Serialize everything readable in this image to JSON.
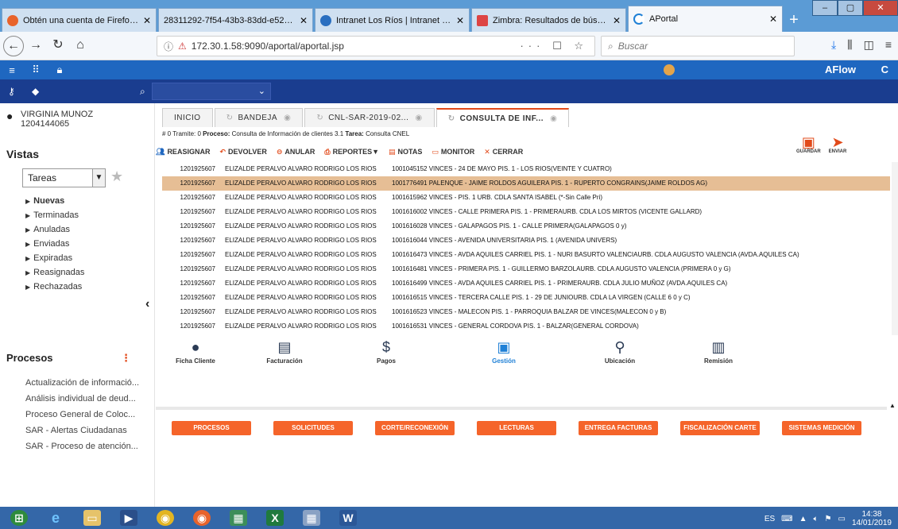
{
  "browser": {
    "tabs": [
      {
        "title": "Obtén una cuenta de Firefox – ",
        "color": "#e8632b"
      },
      {
        "title": "28311292-7f54-43b3-83dd-e529861",
        "color": "#ffffff"
      },
      {
        "title": "Intranet Los Ríos | Intranet Los ",
        "color": "#2a6fc0"
      },
      {
        "title": "Zimbra: Resultados de búsqued",
        "color": "#d44"
      },
      {
        "title": "APortal",
        "color": "#ffffff"
      }
    ],
    "new_tab": "+",
    "url": "172.30.1.58:9090/aportal/aportal.jsp",
    "url_icons": "··· ☐ ☆",
    "search_placeholder": "Buscar"
  },
  "appbar": {
    "brand": "AFlow",
    "refresh": "C"
  },
  "sidebar": {
    "user_name": "VIRGINIA MUNOZ",
    "user_id": "1204144065",
    "vistas_title": "Vistas",
    "vistas_select": "Tareas",
    "vistas_items": [
      "Nuevas",
      "Terminadas",
      "Anuladas",
      "Enviadas",
      "Expiradas",
      "Reasignadas",
      "Rechazadas"
    ],
    "procesos_title": "Procesos",
    "procesos_items": [
      "Actualización de informació...",
      "Análisis individual de deud...",
      "Proceso General de Coloc...",
      "SAR - Alertas Ciudadanas",
      "SAR - Proceso de atención..."
    ]
  },
  "main": {
    "tabs": [
      "INICIO",
      "BANDEJA",
      "CNL-SAR-2019-02...",
      "CONSULTA DE INF..."
    ],
    "info": {
      "tramite_label": "# 0 Tramite:",
      "tramite_val": "0",
      "proceso_label": "Proceso:",
      "proceso_val": "Consulta de Información de clientes 3.1",
      "tarea_label": "Tarea:",
      "tarea_val": "Consulta CNEL"
    },
    "toolbar": [
      "REASIGNAR",
      "DEVOLVER",
      "ANULAR",
      "REPORTES▼",
      "NOTAS",
      "MONITOR",
      "CERRAR"
    ],
    "save_label": "GUARDAR",
    "send_label": "ENVIAR",
    "rows": [
      {
        "id": "1201925607",
        "name": "ELIZALDE PERALVO ALVARO RODRIGO  LOS RIOS",
        "detail": "1001045152  VINCES - 24 DE MAYO PIS. 1 - LOS RIOS(VEINTE Y CUATRO)"
      },
      {
        "id": "1201925607",
        "name": "ELIZALDE PERALVO ALVARO RODRIGO  LOS RIOS",
        "detail": "1001776491  PALENQUE - JAIME ROLDOS AGUILERA PIS. 1 - RUPERTO CONGRAINS(JAIME ROLDOS AG)"
      },
      {
        "id": "1201925607",
        "name": "ELIZALDE PERALVO ALVARO RODRIGO  LOS RIOS",
        "detail": "1001615962  VINCES - PIS. 1 URB. CDLA SANTA ISABEL (*-Sin Calle Pri)"
      },
      {
        "id": "1201925607",
        "name": "ELIZALDE PERALVO ALVARO RODRIGO  LOS RIOS",
        "detail": "1001616002  VINCES - CALLE PRIMERA PIS. 1 - PRIMERAURB. CDLA LOS MIRTOS (VICENTE GALLARD)"
      },
      {
        "id": "1201925607",
        "name": "ELIZALDE PERALVO ALVARO RODRIGO  LOS RIOS",
        "detail": "1001616028  VINCES - GALAPAGOS PIS. 1 - CALLE PRIMERA(GALAPAGOS 0 y)"
      },
      {
        "id": "1201925607",
        "name": "ELIZALDE PERALVO ALVARO RODRIGO  LOS RIOS",
        "detail": "1001616044  VINCES - AVENIDA UNIVERSITARIA PIS. 1 (AVENIDA UNIVERS)"
      },
      {
        "id": "1201925607",
        "name": "ELIZALDE PERALVO ALVARO RODRIGO  LOS RIOS",
        "detail": "1001616473  VINCES - AVDA AQUILES CARRIEL PIS. 1 - NURI BASURTO VALENCIAURB. CDLA AUGUSTO VALENCIA (AVDA.AQUILES CA)"
      },
      {
        "id": "1201925607",
        "name": "ELIZALDE PERALVO ALVARO RODRIGO  LOS RIOS",
        "detail": "1001616481  VINCES - PRIMERA PIS. 1 - GUILLERMO BARZOLAURB. CDLA AUGUSTO VALENCIA (PRIMERA 0 y G)"
      },
      {
        "id": "1201925607",
        "name": "ELIZALDE PERALVO ALVARO RODRIGO  LOS RIOS",
        "detail": "1001616499  VINCES - AVDA AQUILES CARRIEL PIS. 1 - PRIMERAURB. CDLA JULIO MUÑOZ (AVDA.AQUILES CA)"
      },
      {
        "id": "1201925607",
        "name": "ELIZALDE PERALVO ALVARO RODRIGO  LOS RIOS",
        "detail": "1001616515  VINCES - TERCERA CALLE PIS. 1 - 29 DE JUNIOURB. CDLA LA VIRGEN (CALLE 6 0 y C)"
      },
      {
        "id": "1201925607",
        "name": "ELIZALDE PERALVO ALVARO RODRIGO  LOS RIOS",
        "detail": "1001616523  VINCES - MALECON PIS. 1 - PARROQUIA BALZAR DE VINCES(MALECON 0 y B)"
      },
      {
        "id": "1201925607",
        "name": "ELIZALDE PERALVO ALVARO RODRIGO  LOS RIOS",
        "detail": "1001616531  VINCES - GENERAL CORDOVA PIS. 1 - BALZAR(GENERAL CORDOVA)"
      }
    ],
    "selected_row": 1,
    "icon_buttons": [
      "Ficha Cliente",
      "Facturación",
      "Pagos",
      "Gestión",
      "Ubicación",
      "Remisión"
    ],
    "orange_buttons": [
      "PROCESOS",
      "SOLICITUDES",
      "CORTE/RECONEXIÓN",
      "LECTURAS",
      "ENTREGA FACTURAS",
      "FISCALIZACIÓN CARTE",
      "SISTEMAS MEDICIÓN"
    ]
  },
  "taskbar": {
    "lang": "ES",
    "time": "14:38",
    "date": "14/01/2019"
  },
  "colors": {
    "accent": "#f5642a",
    "appbar": "#1f67c0",
    "appbar_dark": "#1a3d8f",
    "selected_row": "#e6be95"
  }
}
